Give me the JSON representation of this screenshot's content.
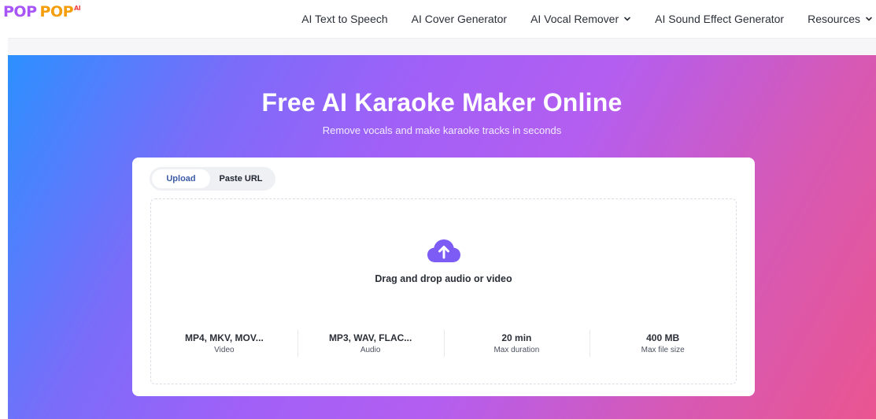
{
  "header": {
    "logo": {
      "word1": "POP",
      "word2": "POP",
      "suffix": "AI"
    },
    "nav": [
      {
        "label": "AI Text to Speech",
        "has_dropdown": false
      },
      {
        "label": "AI Cover Generator",
        "has_dropdown": false
      },
      {
        "label": "AI Vocal Remover",
        "has_dropdown": true
      },
      {
        "label": "AI Sound Effect Generator",
        "has_dropdown": false
      },
      {
        "label": "Resources",
        "has_dropdown": true
      }
    ]
  },
  "hero": {
    "title": "Free AI Karaoke Maker Online",
    "subtitle": "Remove vocals and make karaoke tracks in seconds"
  },
  "upload": {
    "tabs": [
      {
        "label": "Upload",
        "active": true
      },
      {
        "label": "Paste URL",
        "active": false
      }
    ],
    "icon": "cloud-upload-icon",
    "drop_text": "Drag and drop audio or video",
    "stats": [
      {
        "value": "MP4, MKV, MOV...",
        "label": "Video"
      },
      {
        "value": "MP3, WAV, FLAC...",
        "label": "Audio"
      },
      {
        "value": "20 min",
        "label": "Max duration"
      },
      {
        "value": "400 MB",
        "label": "Max file size"
      }
    ]
  },
  "colors": {
    "accent": "#7c5cf5",
    "logo_purple": "#a855f7",
    "logo_orange": "#f59e0b",
    "tab_active_text": "#3c5ba7"
  }
}
